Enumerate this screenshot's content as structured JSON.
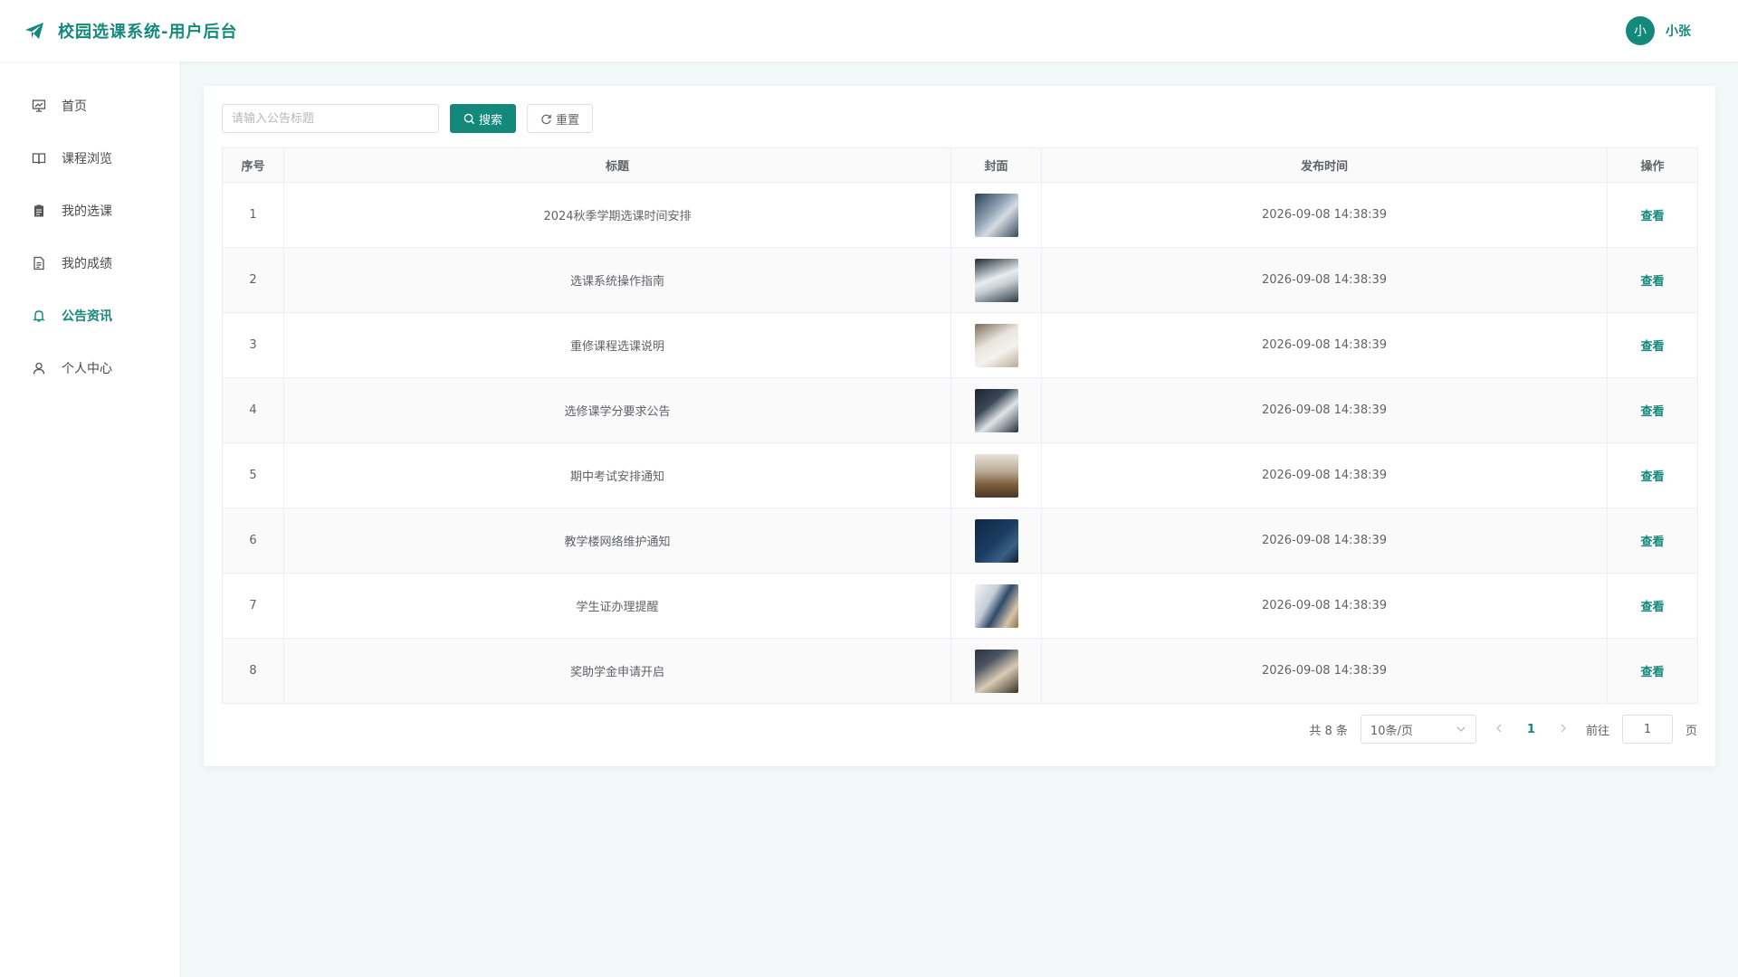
{
  "header": {
    "title": "校园选课系统-用户后台",
    "user_name": "小张",
    "avatar_text": "小"
  },
  "sidebar": {
    "items": [
      {
        "label": "首页",
        "icon": "presentation-icon"
      },
      {
        "label": "课程浏览",
        "icon": "book-icon"
      },
      {
        "label": "我的选课",
        "icon": "clipboard-icon"
      },
      {
        "label": "我的成绩",
        "icon": "document-icon"
      },
      {
        "label": "公告资讯",
        "icon": "bell-icon",
        "active": true
      },
      {
        "label": "个人中心",
        "icon": "user-icon"
      }
    ]
  },
  "toolbar": {
    "search_placeholder": "请输入公告标题",
    "search_label": "搜索",
    "reset_label": "重置"
  },
  "table": {
    "columns": [
      "序号",
      "标题",
      "封面",
      "发布时间",
      "操作"
    ],
    "action_label": "查看",
    "rows": [
      {
        "index": "1",
        "title": "2024秋季学期选课时间安排",
        "time": "2026-09-08 14:38:39"
      },
      {
        "index": "2",
        "title": "选课系统操作指南",
        "time": "2026-09-08 14:38:39"
      },
      {
        "index": "3",
        "title": "重修课程选课说明",
        "time": "2026-09-08 14:38:39"
      },
      {
        "index": "4",
        "title": "选修课学分要求公告",
        "time": "2026-09-08 14:38:39"
      },
      {
        "index": "5",
        "title": "期中考试安排通知",
        "time": "2026-09-08 14:38:39"
      },
      {
        "index": "6",
        "title": "教学楼网络维护通知",
        "time": "2026-09-08 14:38:39"
      },
      {
        "index": "7",
        "title": "学生证办理提醒",
        "time": "2026-09-08 14:38:39"
      },
      {
        "index": "8",
        "title": "奖助学金申请开启",
        "time": "2026-09-08 14:38:39"
      }
    ]
  },
  "pagination": {
    "total_text": "共 8 条",
    "page_size": "10条/页",
    "current_page": "1",
    "goto_label": "前往",
    "goto_value": "1",
    "page_suffix": "页"
  },
  "colors": {
    "accent": "#14897b",
    "background": "#f1faf8"
  }
}
